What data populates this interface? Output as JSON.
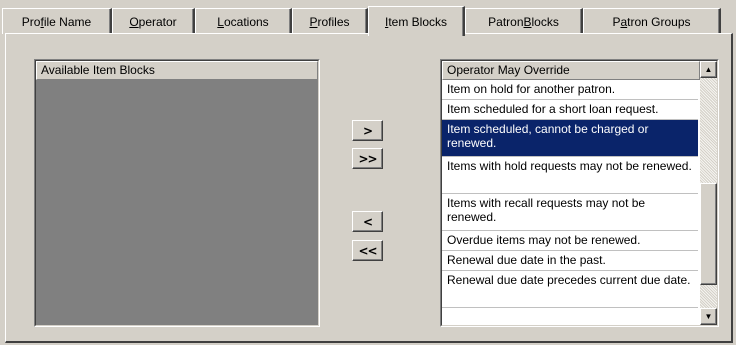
{
  "tabs": [
    {
      "pre": "Pro",
      "key": "f",
      "post": "ile Name"
    },
    {
      "pre": "",
      "key": "O",
      "post": "perator"
    },
    {
      "pre": "",
      "key": "L",
      "post": "ocations"
    },
    {
      "pre": "",
      "key": "P",
      "post": "rofiles"
    },
    {
      "pre": "",
      "key": "I",
      "post": "tem Blocks"
    },
    {
      "pre": "Patron ",
      "key": "B",
      "post": "locks"
    },
    {
      "pre": "P",
      "key": "a",
      "post": "tron Groups"
    }
  ],
  "available_list": {
    "header": "Available Item Blocks"
  },
  "buttons": {
    "add": ">",
    "add_all": ">>",
    "remove": "<",
    "remove_all": "<<"
  },
  "override_list": {
    "header": "Operator May Override",
    "items": [
      "Item on hold for another patron.",
      "Item scheduled for a short loan request.",
      "Item scheduled, cannot be charged or renewed.",
      "Items with hold requests may not be renewed.",
      "Items with recall requests may not be renewed.",
      "Overdue items may not be renewed.",
      "Renewal due date in the past.",
      "Renewal due date precedes current due date."
    ],
    "selected_index": 2
  },
  "scrollbar": {
    "up_arrow": "▲",
    "down_arrow": "▼"
  },
  "colors": {
    "face": "#d4d0c8",
    "selection": "#0a246a",
    "empty_list": "#808080"
  }
}
